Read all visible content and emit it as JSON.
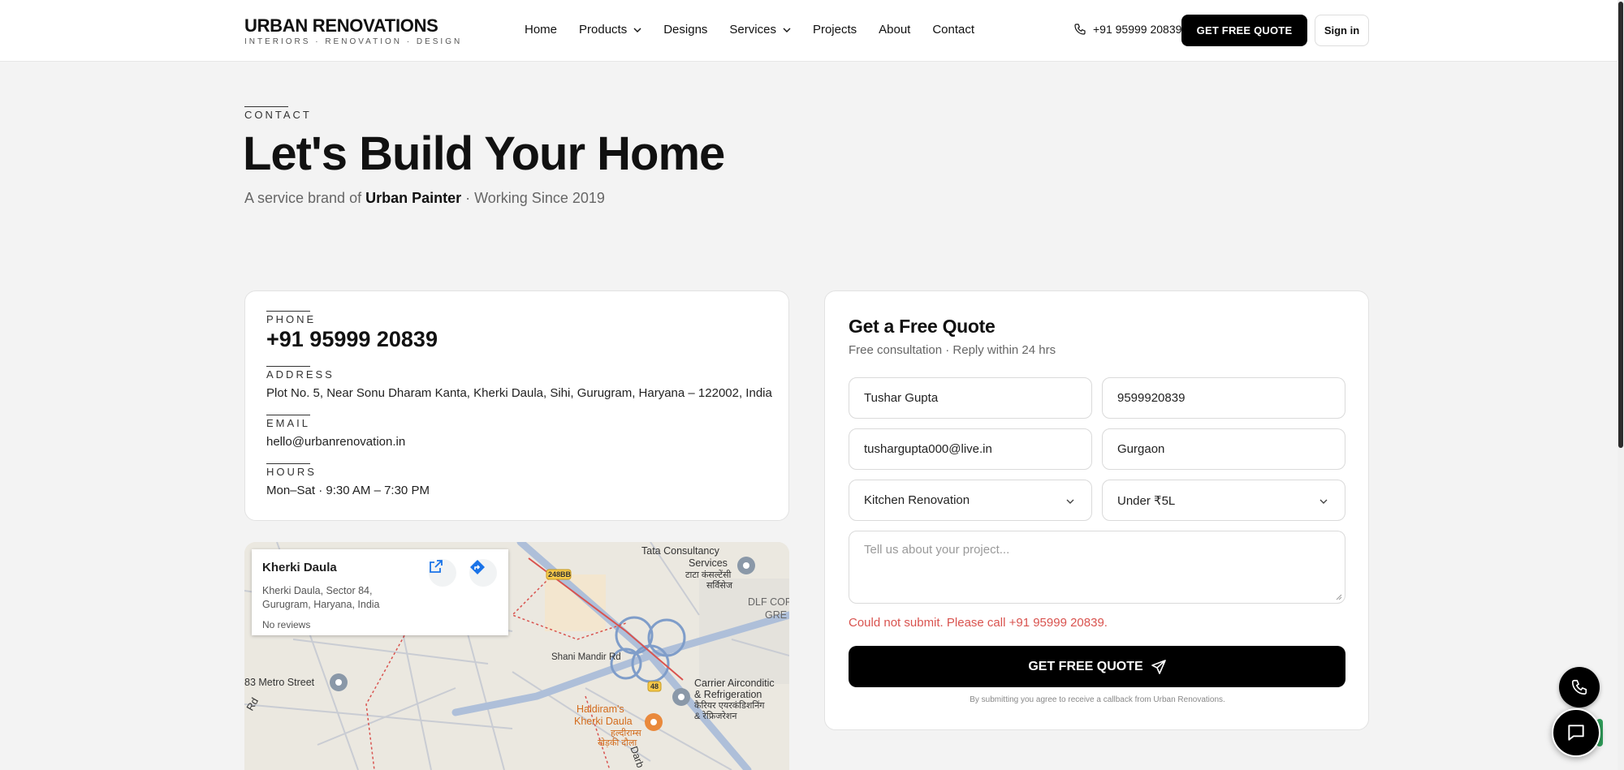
{
  "header": {
    "logo_title": "URBAN RENOVATIONS",
    "logo_sub": "INTERIORS · RENOVATION · DESIGN",
    "nav": [
      "Home",
      "Products",
      "Designs",
      "Services",
      "Projects",
      "About",
      "Contact"
    ],
    "phone": "+91 95999 20839",
    "quote_button": "GET FREE QUOTE",
    "signin_button": "Sign in"
  },
  "hero": {
    "eyebrow": "CONTACT",
    "title": "Let's Build Your Home",
    "sub_prefix": "A service brand of ",
    "sub_brand": "Urban Painter",
    "sub_suffix": " · Working Since 2019"
  },
  "contact": {
    "phone_label": "PHONE",
    "phone": "+91 95999 20839",
    "address_label": "ADDRESS",
    "address": "Plot No. 5, Near Sonu Dharam Kanta, Kherki Daula, Sihi, Gurugram, Haryana – 122002, India",
    "email_label": "EMAIL",
    "email": "hello@urbanrenovation.in",
    "hours_label": "HOURS",
    "hours": "Mon–Sat · 9:30 AM – 7:30 PM"
  },
  "map": {
    "place_title": "Kherki Daula",
    "place_address": "Kherki Daula, Sector 84, Gurugram, Haryana, India",
    "reviews": "No reviews",
    "labels": {
      "tata_1": "Tata Consultancy",
      "tata_2": "Services",
      "tata_hi_1": "टाटा कंसल्टेंसी",
      "tata_hi_2": "सर्विसेज",
      "dlf_1": "DLF CORPOR",
      "dlf_2": "GRE",
      "shani": "Shani Mandir Rd",
      "metro": "83 Metro Street",
      "carrier_1": "Carrier Airconditic",
      "carrier_2": "& Refrigeration",
      "carrier_hi_1": "कैरियर एयरकंडिशनिंग",
      "carrier_hi_2": "& रेफ्रिजरेशन",
      "haldiram_1": "Haldiram's",
      "haldiram_2": "Kherki Daula",
      "haldiram_hi_1": "हल्दीराम्स",
      "haldiram_hi_2": "खेड़की दौला",
      "road_248bb": "248BB",
      "road_48": "48",
      "rd_left": "Rd",
      "darb": "Darb"
    }
  },
  "quote": {
    "title": "Get a Free Quote",
    "subtitle": "Free consultation · Reply within 24 hrs",
    "name_value": "Tushar Gupta",
    "phone_value": "9599920839",
    "email_value": "tushargupta000@live.in",
    "city_value": "Gurgaon",
    "service_value": "Kitchen Renovation",
    "budget_value": "Under ₹5L",
    "message_placeholder": "Tell us about your project...",
    "error": "Could not submit. Please call +91 95999 20839.",
    "submit": "GET FREE QUOTE",
    "consent": "By submitting you agree to receive a callback from Urban Renovations."
  },
  "colors": {
    "accent": "#000000",
    "error": "#d9534f",
    "page_bg": "#f3f3f3"
  }
}
